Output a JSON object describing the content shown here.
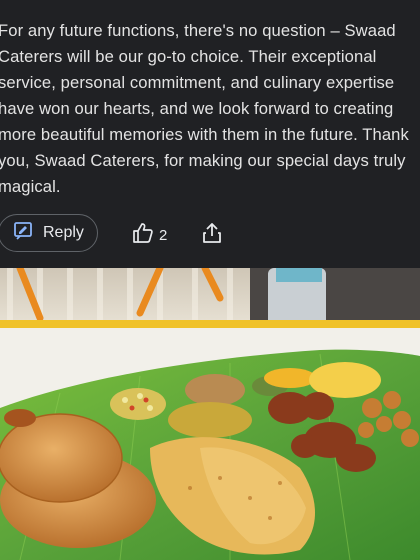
{
  "review": {
    "text": "For any future functions, there's no question – Swaad\nCaterers will be our go-to choice. Their exceptional\nservice, personal commitment, and culinary expertise\nhave won our hearts, and we look forward to creating\nmore beautiful memories with them in the future. Thank\nyou, Swaad Caterers, for making our special days truly\nmagical."
  },
  "actions": {
    "reply_label": "Reply",
    "like_count": "2"
  },
  "photo": {
    "subject": "banana-leaf-meal",
    "colors": {
      "leaf": "#5aa33a",
      "table": "#f2f0ea",
      "marigold": "#e98a1f"
    }
  }
}
